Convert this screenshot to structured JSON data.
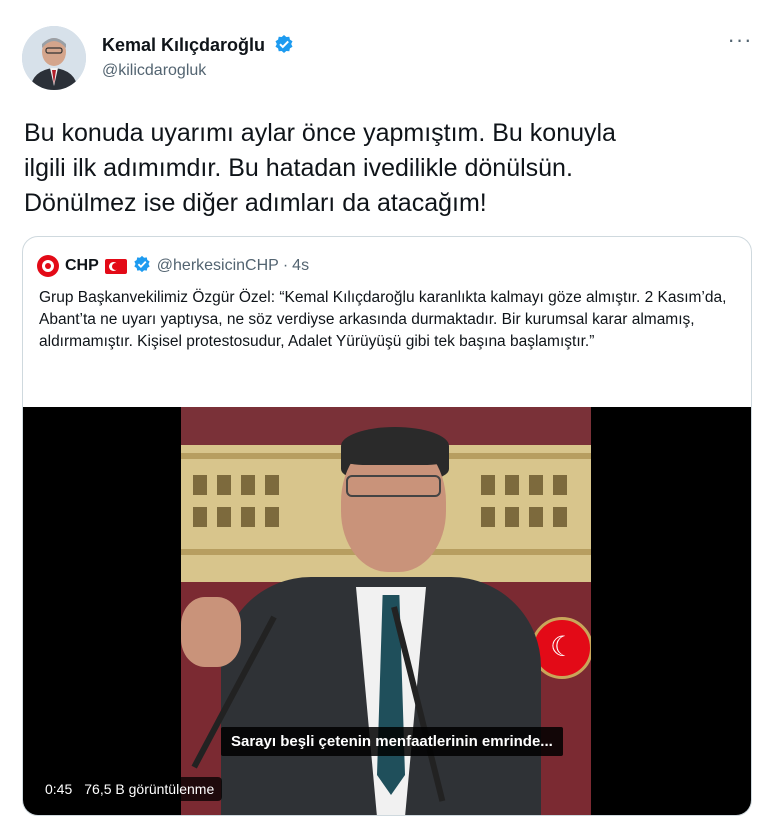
{
  "author": {
    "name": "Kemal Kılıçdaroğlu",
    "handle": "@kilicdarogluk",
    "verified_icon": "verified-badge-icon",
    "accent_color": "#1d9bf0"
  },
  "more_label": "···",
  "tweet": {
    "text": "Bu konuda uyarımı aylar önce yapmıştım. Bu konuyla\nilgili ilk adımımdır. Bu hatadan ivedilikle dönülsün.\nDönülmez ise diğer adımları da atacağım!"
  },
  "quote": {
    "name": "CHP",
    "handle": "@herkesicinCHP",
    "separator": "·",
    "time": "4s",
    "text": "Grup Başkanvekilimiz Özgür Özel: “Kemal Kılıçdaroğlu karanlıkta kalmayı göze almıştır. 2 Kasım’da, Abant’ta ne uyarı yaptıysa, ne söz verdiyse arkasında durmaktadır. Bir kurumsal karar almamış, aldırmamıştır. Kişisel protestosudur, Adalet Yürüyüşü gibi tek başına başlamıştır.”",
    "video": {
      "subtitle": "Sarayı beşli çetenin menfaatlerinin emrinde...",
      "duration": "0:45",
      "views": "76,5 B görüntülenme"
    }
  }
}
